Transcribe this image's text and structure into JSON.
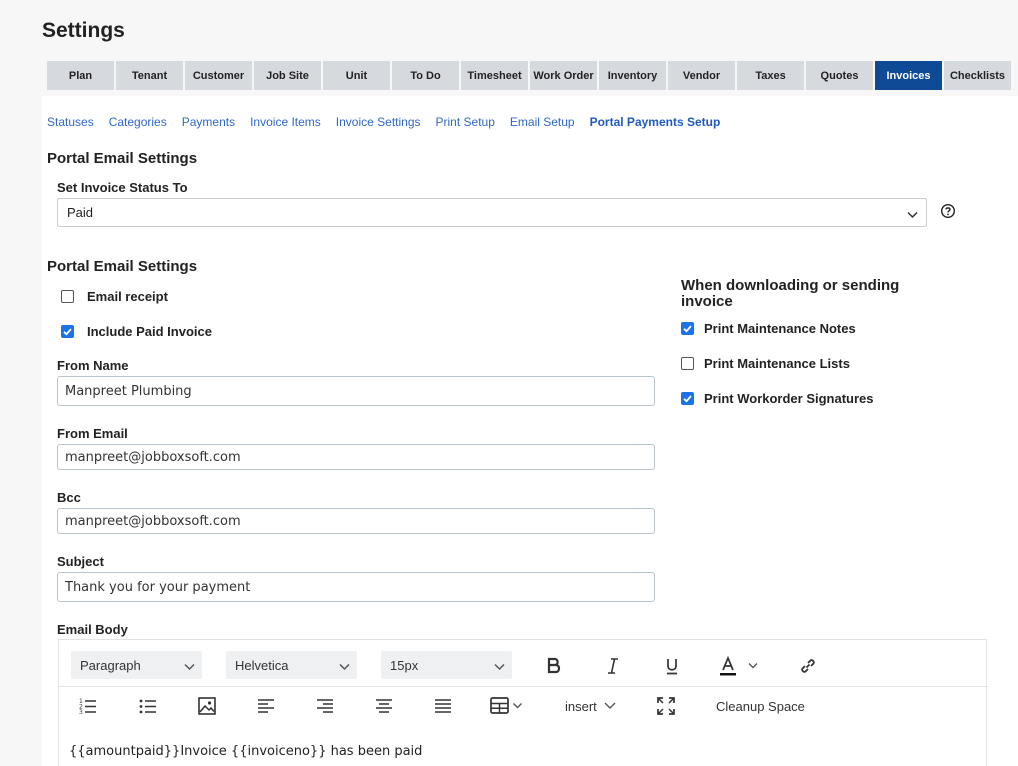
{
  "page": {
    "title": "Settings"
  },
  "tabs": [
    {
      "label": "Plan"
    },
    {
      "label": "Tenant"
    },
    {
      "label": "Customer"
    },
    {
      "label": "Job Site"
    },
    {
      "label": "Unit"
    },
    {
      "label": "To Do"
    },
    {
      "label": "Timesheet"
    },
    {
      "label": "Work Order"
    },
    {
      "label": "Inventory"
    },
    {
      "label": "Vendor"
    },
    {
      "label": "Taxes"
    },
    {
      "label": "Quotes"
    },
    {
      "label": "Invoices"
    },
    {
      "label": "Checklists"
    }
  ],
  "active_tab": "Invoices",
  "subnav": [
    {
      "label": "Statuses"
    },
    {
      "label": "Categories"
    },
    {
      "label": "Payments"
    },
    {
      "label": "Invoice Items"
    },
    {
      "label": "Invoice Settings"
    },
    {
      "label": "Print Setup"
    },
    {
      "label": "Email Setup"
    },
    {
      "label": "Portal Payments Setup"
    }
  ],
  "active_subnav": "Portal Payments Setup",
  "status_section": {
    "title": "Portal Email Settings",
    "label": "Set Invoice Status To",
    "value": "Paid"
  },
  "email_section": {
    "title": "Portal Email Settings",
    "email_receipt": {
      "label": "Email receipt",
      "checked": false
    },
    "include_paid_invoice": {
      "label": "Include Paid Invoice",
      "checked": true
    },
    "from_name": {
      "label": "From Name",
      "value": "Manpreet Plumbing"
    },
    "from_email": {
      "label": "From Email",
      "value": "manpreet@jobboxsoft.com"
    },
    "bcc": {
      "label": "Bcc",
      "value": "manpreet@jobboxsoft.com"
    },
    "subject": {
      "label": "Subject",
      "value": "Thank you for your payment"
    },
    "email_body_label": "Email Body"
  },
  "download_section": {
    "title": "When downloading or sending invoice",
    "print_maintenance_notes": {
      "label": "Print Maintenance Notes",
      "checked": true
    },
    "print_maintenance_lists": {
      "label": "Print Maintenance Lists",
      "checked": false
    },
    "print_workorder_signatures": {
      "label": "Print Workorder Signatures",
      "checked": true
    }
  },
  "editor": {
    "block_format": "Paragraph",
    "font_family": "Helvetica",
    "font_size": "15px",
    "insert_label": "insert",
    "cleanup_label": "Cleanup Space",
    "content": "{{amountpaid}}Invoice {{invoiceno}} has been paid"
  },
  "colors": {
    "accent": "#0e4a95",
    "link": "#2f68c8",
    "checkbox": "#1a73e8"
  }
}
